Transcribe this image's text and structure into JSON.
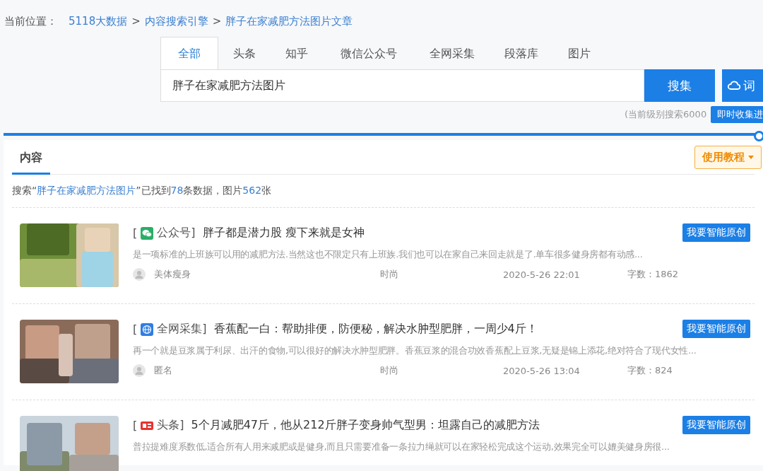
{
  "breadcrumb": {
    "label": "当前位置：",
    "links": [
      "5118大数据",
      "内容搜索引擎",
      "胖子在家减肥方法图片文章"
    ],
    "separator": ">"
  },
  "search_tabs": [
    {
      "label": "全部",
      "selected": true
    },
    {
      "label": "头条",
      "selected": false
    },
    {
      "label": "知乎",
      "selected": false
    },
    {
      "label": "微信公众号",
      "selected": false
    },
    {
      "label": "全网采集",
      "selected": false
    },
    {
      "label": "段落库",
      "selected": false
    },
    {
      "label": "图片",
      "selected": false
    }
  ],
  "search": {
    "value": "胖子在家减肥方法图片",
    "button": "搜集",
    "cloud_button": "词"
  },
  "note": "(当前级别搜索6000",
  "tooltip": "即时收集进",
  "content_tab": {
    "label": "内容",
    "selected": true
  },
  "tutorial_button": "使用教程",
  "summary": [
    {
      "text": "搜索“",
      "highlight": false
    },
    {
      "text": "胖子在家减肥方法图片",
      "highlight": true
    },
    {
      "text": "”已找到",
      "highlight": false
    },
    {
      "text": "78",
      "highlight": true
    },
    {
      "text": "条数据，图片",
      "highlight": false
    },
    {
      "text": "562",
      "highlight": true
    },
    {
      "text": "张",
      "highlight": false
    }
  ],
  "results": [
    {
      "bracket": "[",
      "kind": "wechat",
      "source": "公众号]",
      "title": "胖子都是潜力股 瘦下来就是女神",
      "button": "我要智能原创",
      "snippet": "是一项标准的上班族可以用的减肥方法.当然这也不限定只有上班族.我们也可以在家自己来回走就是了.单车很多健身房都有动感...",
      "author": "美体瘦身",
      "category": "时尚",
      "date": "2020-5-26 22:01",
      "word_count": "字数：1862"
    },
    {
      "bracket": "[",
      "kind": "web",
      "source": "全网采集]",
      "title": "香蕉配一白：帮助排便，防便秘，解决水肿型肥胖，一周少4斤！",
      "button": "我要智能原创",
      "snippet": "再一个就是豆浆属于利尿、出汗的食物,可以很好的解决水肿型肥胖。香蕉豆浆的混合功效香蕉配上豆浆,无疑是锦上添花,绝对符合了现代女性...",
      "author": "匿名",
      "category": "时尚",
      "date": "2020-5-26 13:04",
      "word_count": "字数：824"
    },
    {
      "bracket": "[",
      "kind": "toutiao",
      "source": "头条]",
      "title": "5个月减肥47斤，他从212斤胖子变身帅气型男：坦露自己的减肥方法",
      "button": "我要智能原创",
      "snippet": "普拉提难度系数低,适合所有人用来减肥或是健身,而且只需要准备一条拉力绳就可以在家轻松完成这个运动,效果完全可以媲美健身房很..."
    }
  ]
}
